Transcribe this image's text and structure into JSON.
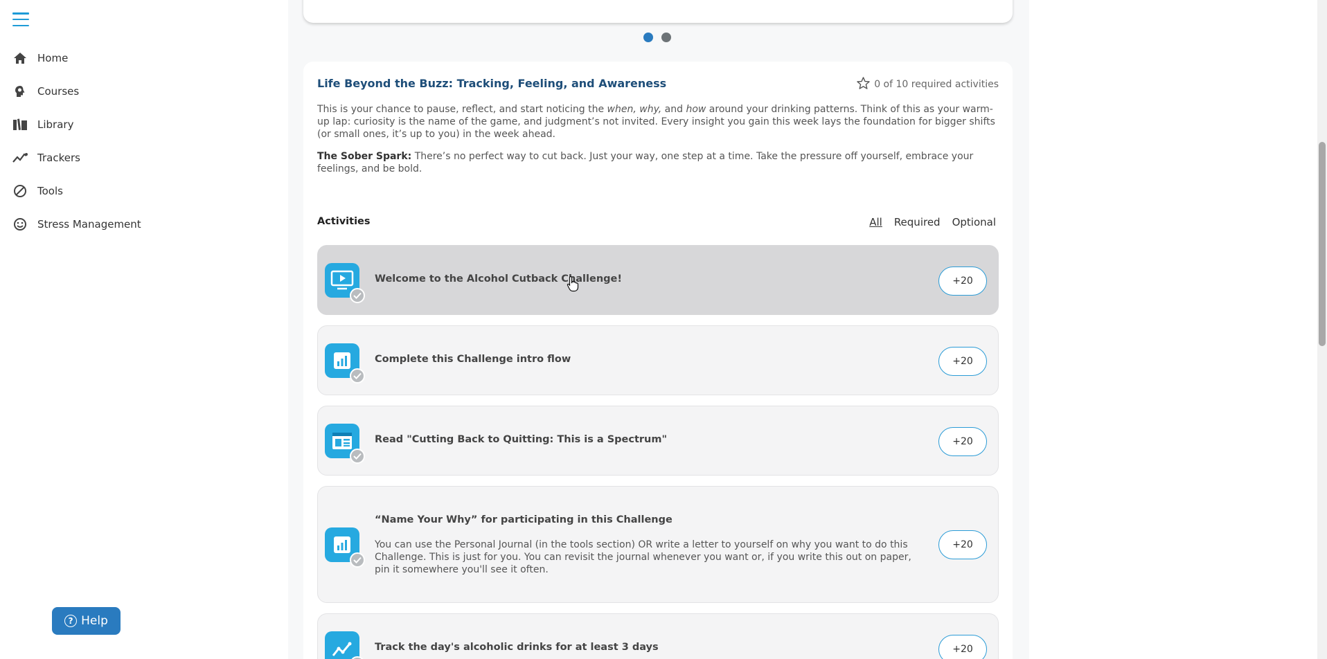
{
  "sidebar": {
    "items": [
      {
        "label": "Home",
        "icon": "home-icon"
      },
      {
        "label": "Courses",
        "icon": "courses-icon"
      },
      {
        "label": "Library",
        "icon": "library-icon"
      },
      {
        "label": "Trackers",
        "icon": "trackers-icon"
      },
      {
        "label": "Tools",
        "icon": "tools-icon"
      },
      {
        "label": "Stress Management",
        "icon": "smiley-icon"
      }
    ],
    "help_label": "Help"
  },
  "carousel": {
    "slides": 2,
    "active_index": 0
  },
  "module": {
    "title": "Life Beyond the Buzz: Tracking, Feeling, and Awareness",
    "required_status": "0 of 10 required activities",
    "description_part1": "This is your chance to pause, reflect, and start noticing the ",
    "description_em1": "when, why,",
    "description_part2": " and ",
    "description_em2": "how",
    "description_part3": " around your drinking patterns. Think of this as your warm-up lap: curiosity is the name of the game, and judgment’s not invited. Every insight you gain this week lays the foundation for bigger shifts (or small ones, it’s up to you) in the week ahead.",
    "spark_label": "The Sober Spark:",
    "spark_text": " There’s no perfect way to cut back. Just your way, one step at a time. Take the pressure off yourself, embrace your feelings, and be bold."
  },
  "activities_section": {
    "title": "Activities",
    "filters": [
      "All",
      "Required",
      "Optional"
    ],
    "active_filter": "All"
  },
  "activities": [
    {
      "name": "Welcome to the Alcohol Cutback Challenge!",
      "points": "+20",
      "icon": "video-icon"
    },
    {
      "name": "Complete this Challenge intro flow",
      "points": "+20",
      "icon": "chart-icon"
    },
    {
      "name": "Read \"Cutting Back to Quitting: This is a Spectrum\"",
      "points": "+20",
      "icon": "article-icon"
    },
    {
      "name": "“Name Your Why” for participating in this Challenge",
      "body": "You can use the Personal Journal (in the tools section) OR write a letter to yourself on why you want to do this Challenge. This is just for you. You can revisit the journal whenever you want or, if you write this out on paper, pin it somewhere you'll see it often.",
      "points": "+20",
      "icon": "chart-icon"
    },
    {
      "name": "Track the day's alcoholic drinks for at least 3 days",
      "points": "+20",
      "icon": "tracker-icon"
    }
  ],
  "colors": {
    "accent": "#26a9e0",
    "title": "#1e4e79",
    "help": "#2a7bbf"
  }
}
